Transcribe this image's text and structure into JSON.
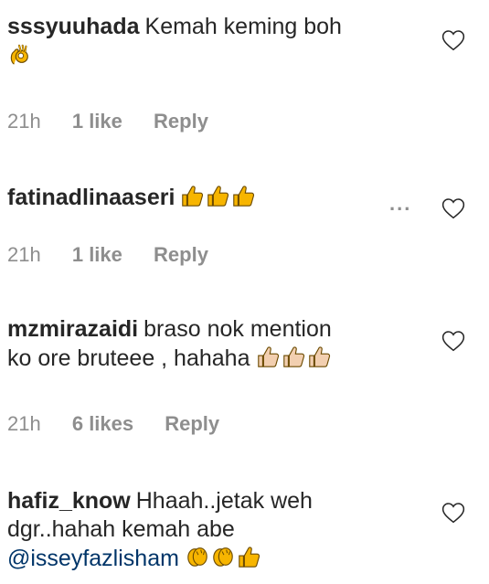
{
  "comments": [
    {
      "username": "sssyuuhada",
      "text": "Kemah keming boh",
      "emojis": [
        "ok-hand-icon"
      ],
      "time": "21h",
      "likes": "1 like",
      "reply": "Reply"
    },
    {
      "username": "fatinadlinaaseri",
      "text": "",
      "emojis": [
        "thumbs-up-icon",
        "thumbs-up-icon",
        "thumbs-up-icon"
      ],
      "time": "21h",
      "likes": "1 like",
      "reply": "Reply",
      "more": "..."
    },
    {
      "username": "mzmirazaidi",
      "text_line1": "braso nok mention",
      "text_line2": "ko ore bruteee , hahaha",
      "emojis": [
        "thumbs-up-light-icon",
        "thumbs-up-light-icon",
        "thumbs-up-light-icon"
      ],
      "time": "21h",
      "likes": "6 likes",
      "reply": "Reply"
    },
    {
      "username": "hafiz_know",
      "text_line1": "Hhaah..jetak weh",
      "text_line2": "dgr..hahah kemah abe",
      "mention": "@isseyfazlisham",
      "emojis": [
        "clapping-hands-icon",
        "clapping-hands-icon",
        "thumbs-up-icon"
      ]
    }
  ],
  "colors": {
    "text": "#262626",
    "meta": "#8e8e8e",
    "mention": "#003569",
    "emoji_yellow": "#f7b500",
    "emoji_light": "#f2cfb0"
  }
}
